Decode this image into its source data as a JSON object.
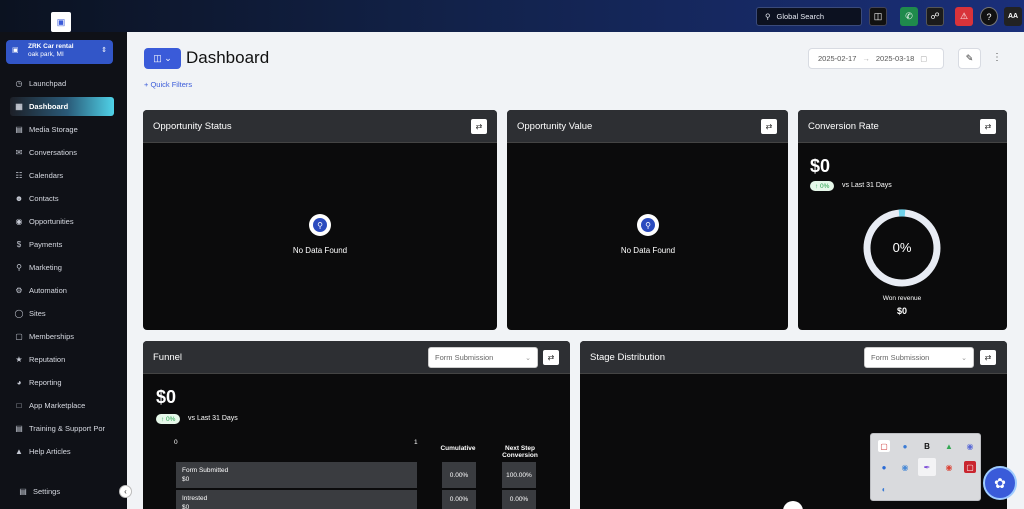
{
  "topbar": {
    "search_label": "Global Search",
    "avatar_initials": "AA"
  },
  "sidebar": {
    "account_name": "ZRK Car rental",
    "account_location": "oak park, MI",
    "items": [
      {
        "label": "Launchpad",
        "icon": "launchpad-icon"
      },
      {
        "label": "Dashboard",
        "icon": "dashboard-icon",
        "active": true
      },
      {
        "label": "Media Storage",
        "icon": "media-icon"
      },
      {
        "label": "Conversations",
        "icon": "conversations-icon"
      },
      {
        "label": "Calendars",
        "icon": "calendar-icon"
      },
      {
        "label": "Contacts",
        "icon": "contacts-icon"
      },
      {
        "label": "Opportunities",
        "icon": "opportunities-icon"
      },
      {
        "label": "Payments",
        "icon": "payments-icon"
      },
      {
        "label": "Marketing",
        "icon": "marketing-icon"
      },
      {
        "label": "Automation",
        "icon": "automation-icon"
      },
      {
        "label": "Sites",
        "icon": "sites-icon"
      },
      {
        "label": "Memberships",
        "icon": "memberships-icon"
      },
      {
        "label": "Reputation",
        "icon": "reputation-icon"
      },
      {
        "label": "Reporting",
        "icon": "reporting-icon"
      },
      {
        "label": "App Marketplace",
        "icon": "marketplace-icon"
      },
      {
        "label": "Training & Support Por",
        "icon": "training-icon"
      },
      {
        "label": "Help Articles",
        "icon": "help-articles-icon"
      }
    ],
    "settings_label": "Settings"
  },
  "header": {
    "title": "Dashboard",
    "quick_filters": "+ Quick Filters",
    "date_start": "2025-02-17",
    "date_end": "2025-03-18"
  },
  "cards": {
    "opportunity_status": {
      "title": "Opportunity Status",
      "empty_text": "No Data Found"
    },
    "opportunity_value": {
      "title": "Opportunity Value",
      "empty_text": "No Data Found"
    },
    "conversion_rate": {
      "title": "Conversion Rate",
      "value": "$0",
      "change": "↑ 0%",
      "compare_text": "vs Last 31 Days",
      "gauge_percent": "0%",
      "gauge_fraction": 0.0,
      "won_label": "Won revenue",
      "won_value": "$0"
    },
    "funnel": {
      "title": "Funnel",
      "select_value": "Form Submission",
      "value": "$0",
      "change": "↑ 0%",
      "compare_text": "vs Last 31 Days",
      "axis_min": "0",
      "axis_max": "1",
      "col_cumulative": "Cumulative",
      "col_next_step": "Next Step Conversion",
      "rows": [
        {
          "name": "Form Submitted",
          "value": "$0",
          "cumulative": "0.00%",
          "next": "100.00%"
        },
        {
          "name": "Intrested",
          "value": "$0",
          "cumulative": "0.00%",
          "next": "0.00%"
        }
      ]
    },
    "stage_distribution": {
      "title": "Stage Distribution",
      "select_value": "Form Submission"
    }
  },
  "colors": {
    "accent": "#3a5bd9",
    "positive": "#23a14a",
    "card_bg": "#0b0b0c",
    "card_head": "#2d2f33"
  }
}
